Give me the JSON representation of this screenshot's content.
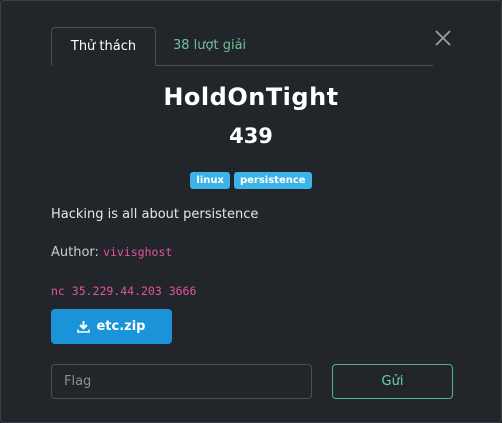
{
  "tabs": {
    "challenge_label": "Thử thách",
    "solves_label": "38 lượt giải"
  },
  "close": {
    "icon": "close-icon"
  },
  "challenge": {
    "name": "HoldOnTight",
    "points": "439",
    "tags": [
      "linux",
      "persistence"
    ],
    "description": "Hacking is all about persistence",
    "author_label": "Author:",
    "author_name": "vivisghost",
    "connection": "nc 35.229.44.203 3666"
  },
  "file": {
    "label": "etc.zip",
    "icon": "download-icon"
  },
  "flag": {
    "placeholder": "Flag",
    "value": ""
  },
  "submit": {
    "label": "Gửi"
  },
  "colors": {
    "background": "#22262a",
    "tag": "#3cb4e8",
    "file_button": "#1a93d8",
    "submit_border": "#4fb392",
    "author_text": "#e0559c",
    "solves_tab_text": "#6fbf9b"
  }
}
